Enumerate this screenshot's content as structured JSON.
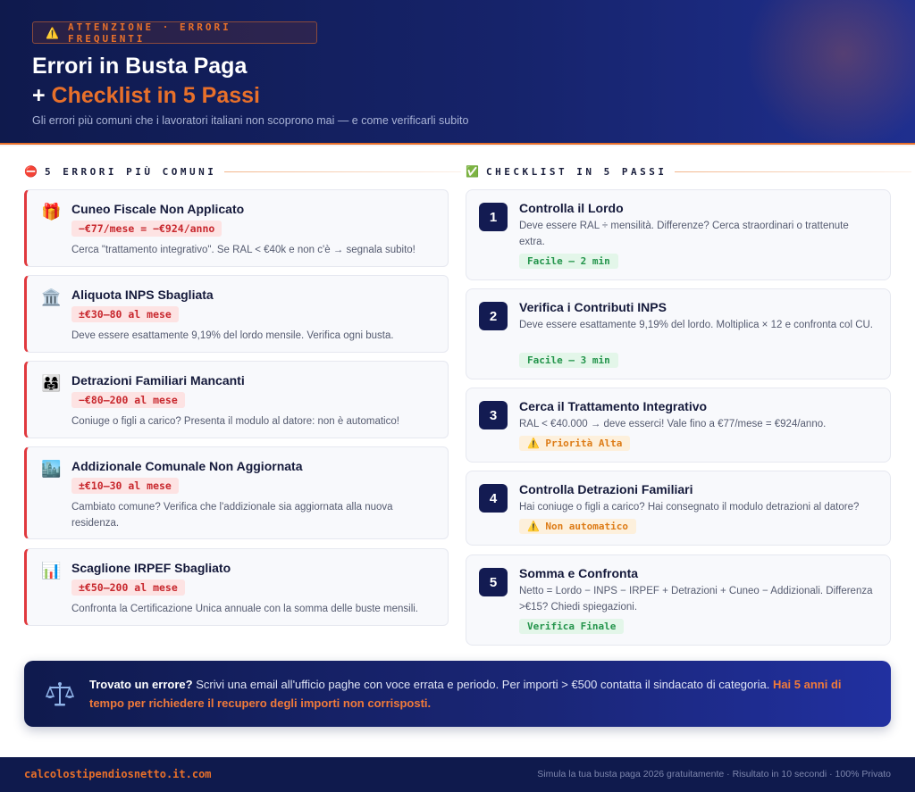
{
  "header": {
    "badge_icon": "warning-icon",
    "badge_text": "ATTENZIONE · ERRORI FREQUENTI",
    "title_line1": "Errori in Busta Paga",
    "title_line2_prefix": "+ ",
    "title_line2_accent": "Checklist in 5 Passi",
    "subtitle": "Gli errori più comuni che i lavoratori italiani non scoprono mai — e come verificarli subito"
  },
  "colors": {
    "navy": "#0f1a4d",
    "accent_orange": "#e8702a",
    "error_red": "#e0393e",
    "success_green": "#23944b",
    "warning_orange": "#dd7b16"
  },
  "errors_section": {
    "icon": "no-entry-icon",
    "title": "5 ERRORI PIÙ COMUNI",
    "items": [
      {
        "icon": "gift-icon",
        "title": "Cuneo Fiscale Non Applicato",
        "amount": "−€77/mese = −€924/anno",
        "description": "Cerca \"trattamento integrativo\". Se RAL < €40k e non c'è → segnala subito!"
      },
      {
        "icon": "bank-building-icon",
        "title": "Aliquota INPS Sbagliata",
        "amount": "±€30–80 al mese",
        "description": "Deve essere esattamente 9,19% del lordo mensile. Verifica ogni busta."
      },
      {
        "icon": "family-icon",
        "title": "Detrazioni Familiari Mancanti",
        "amount": "−€80–200 al mese",
        "description": "Coniuge o figli a carico? Presenta il modulo al datore: non è automatico!"
      },
      {
        "icon": "cityscape-icon",
        "title": "Addizionale Comunale Non Aggiornata",
        "amount": "±€10–30 al mese",
        "description": "Cambiato comune? Verifica che l'addizionale sia aggiornata alla nuova residenza."
      },
      {
        "icon": "bar-chart-icon",
        "title": "Scaglione IRPEF Sbagliato",
        "amount": "±€50–200 al mese",
        "description": "Confronta la Certificazione Unica annuale con la somma delle buste mensili."
      }
    ]
  },
  "checklist_section": {
    "icon": "check-mark-icon",
    "title": "CHECKLIST IN 5 PASSI",
    "steps": [
      {
        "number": "1",
        "title": "Controlla il Lordo",
        "description": "Deve essere RAL ÷ mensilità. Differenze? Cerca straordinari o trattenute extra.",
        "tag": "Facile — 2 min",
        "tag_style": "green"
      },
      {
        "number": "2",
        "title": "Verifica i Contributi INPS",
        "description": "Deve essere esattamente 9,19% del lordo. Moltiplica × 12 e confronta col CU.",
        "tag": "Facile — 3 min",
        "tag_style": "green"
      },
      {
        "number": "3",
        "title": "Cerca il Trattamento Integrativo",
        "description": "RAL < €40.000 → deve esserci! Vale fino a €77/mese = €924/anno.",
        "tag": "⚠️ Priorità Alta",
        "tag_style": "orange"
      },
      {
        "number": "4",
        "title": "Controlla Detrazioni Familiari",
        "description": "Hai coniuge o figli a carico? Hai consegnato il modulo detrazioni al datore?",
        "tag": "⚠️ Non automatico",
        "tag_style": "orange"
      },
      {
        "number": "5",
        "title": "Somma e Confronta",
        "description": "Netto = Lordo − INPS − IRPEF + Detrazioni + Cuneo − Addizionali. Differenza >€15? Chiedi spiegazioni.",
        "tag": "Verifica Finale",
        "tag_style": "green"
      }
    ]
  },
  "callout": {
    "icon": "balance-scale-icon",
    "lead": "Trovato un errore?",
    "body": " Scrivi una email all'ufficio paghe con voce errata e periodo. Per importi > €500 contatta il sindacato di categoria. ",
    "highlight": "Hai 5 anni di tempo per richiedere il recupero degli importi non corrisposti."
  },
  "footer": {
    "site": "calcolostipendiosnetto.it.com",
    "tagline": "Simula la tua busta paga 2026 gratuitamente · Risultato in 10 secondi · 100% Privato"
  }
}
